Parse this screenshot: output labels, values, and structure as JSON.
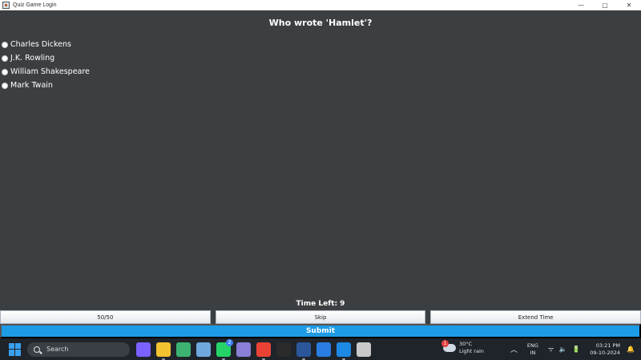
{
  "window": {
    "title": "Quiz Game Login",
    "controls": {
      "minimize": "—",
      "maximize": "▢",
      "close": "✕"
    }
  },
  "quiz": {
    "question": "Who wrote 'Hamlet'?",
    "options": [
      "Charles Dickens",
      "J.K. Rowling",
      "William Shakespeare",
      "Mark Twain"
    ],
    "timer_label": "Time Left: 9",
    "lifelines": [
      "50/50",
      "Skip",
      "Extend Time"
    ],
    "submit_label": "Submit"
  },
  "taskbar": {
    "search_label": "Search",
    "apps": [
      {
        "name": "copilot-icon",
        "color": "#7b61ff"
      },
      {
        "name": "file-explorer-icon",
        "color": "#f2c230"
      },
      {
        "name": "widgets-icon",
        "color": "#3cb371"
      },
      {
        "name": "photos-icon",
        "color": "#6fa8dc"
      },
      {
        "name": "whatsapp-icon",
        "color": "#25d366",
        "badge": "2"
      },
      {
        "name": "media-app-icon",
        "color": "#8a7fd6"
      },
      {
        "name": "chrome-icon",
        "color": "#ea4335"
      },
      {
        "name": "terminal-icon",
        "color": "#2b2b2b"
      },
      {
        "name": "word-icon",
        "color": "#2b579a"
      },
      {
        "name": "snipping-tool-icon",
        "color": "#2a7de1"
      },
      {
        "name": "vscode-icon",
        "color": "#1e88e5"
      },
      {
        "name": "java-app-icon",
        "color": "#c9c9c9"
      }
    ],
    "weather": {
      "badge": "1",
      "temp": "30°C",
      "desc": "Light rain"
    },
    "tray": {
      "chevron": "︿",
      "lang_top": "ENG",
      "lang_bottom": "IN",
      "sys_icons": "ᯤ 🔈 🔋",
      "time": "03:21 PM",
      "date": "09-10-2024",
      "bell": "🔔"
    }
  }
}
